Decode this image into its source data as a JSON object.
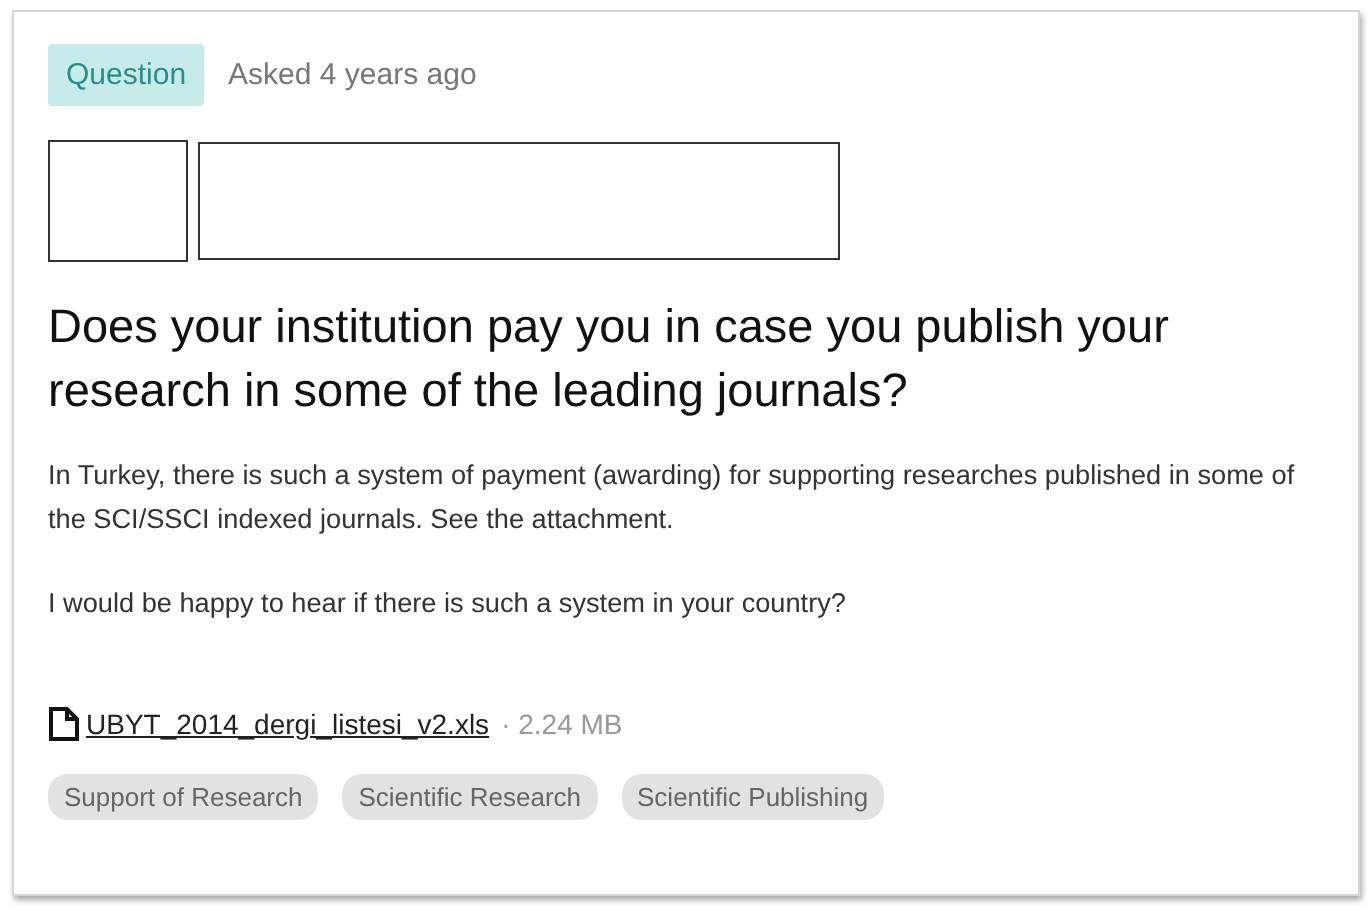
{
  "badge": "Question",
  "asked": "Asked 4 years ago",
  "title": "Does your institution pay you in case you publish your research in some of the leading journals?",
  "paragraphs": [
    "In Turkey, there is such a system of payment (awarding) for supporting researches published in some of the SCI/SSCI indexed journals. See the attachment.",
    "I would be happy to hear if there is such a system in your country?"
  ],
  "attachment": {
    "name": "UBYT_2014_dergi_listesi_v2.xls",
    "size": "· 2.24 MB"
  },
  "tags": [
    "Support of Research",
    "Scientific Research",
    "Scientific Publishing"
  ]
}
